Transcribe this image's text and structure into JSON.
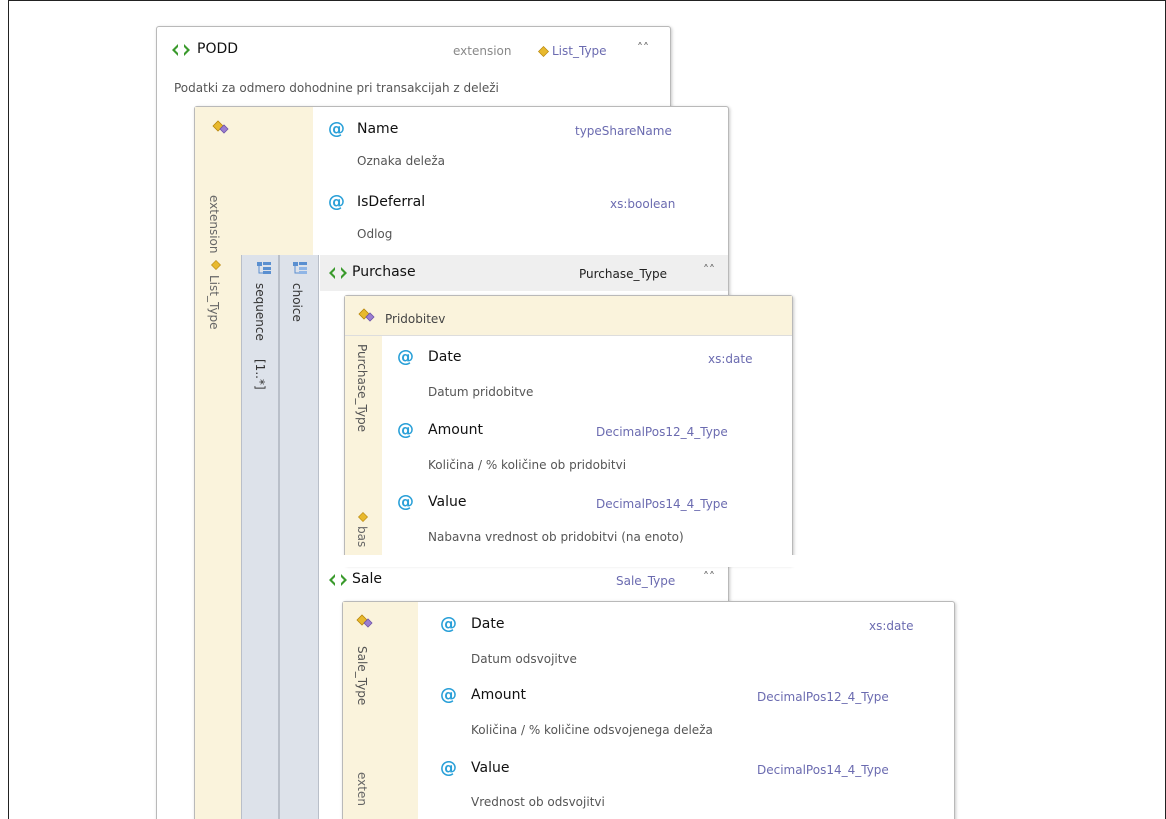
{
  "podd": {
    "name": "PODD",
    "extension_label": "extension",
    "extension_type": "List_Type",
    "description": "Podatki za odmero dohodnine pri transakcijah z deleži"
  },
  "list_ext": {
    "vertical_label": "extension",
    "vertical_type": "List_Type",
    "sequence_label": "sequence",
    "sequence_mult": "[1..*]",
    "choice_label": "choice"
  },
  "attributes": [
    {
      "name": "Name",
      "type": "typeShareName",
      "description": "Oznaka deleža"
    },
    {
      "name": "IsDeferral",
      "type": "xs:boolean",
      "description": "Odlog"
    }
  ],
  "purchase": {
    "name": "Purchase",
    "type": "Purchase_Type",
    "header_label": "Pridobitev",
    "vertical_type": "Purchase_Type",
    "vertical_base": "bas",
    "attributes": [
      {
        "name": "Date",
        "type": "xs:date",
        "description": "Datum pridobitve"
      },
      {
        "name": "Amount",
        "type": "DecimalPos12_4_Type",
        "description": "Količina / % količine ob pridobitvi"
      },
      {
        "name": "Value",
        "type": "DecimalPos14_4_Type",
        "description": "Nabavna vrednost ob pridobitvi (na enoto)"
      }
    ]
  },
  "sale": {
    "name": "Sale",
    "type": "Sale_Type",
    "vertical_type": "Sale_Type",
    "vertical_ext": "exten",
    "attributes": [
      {
        "name": "Date",
        "type": "xs:date",
        "description": "Datum odsvojitve"
      },
      {
        "name": "Amount",
        "type": "DecimalPos12_4_Type",
        "description": "Količina / % količine odsvojenega deleža"
      },
      {
        "name": "Value",
        "type": "DecimalPos14_4_Type",
        "description": "Vrednost ob odsvojitvi"
      }
    ]
  },
  "icons": {
    "element": "element-icon",
    "attribute": "attribute-icon",
    "collapse": "collapse-icon",
    "extension": "extension-icon",
    "sequence": "sequence-icon",
    "choice": "choice-icon",
    "type_diamond": "type-diamond-icon"
  },
  "colors": {
    "element_green": "#3a9a2c",
    "attribute_blue": "#2aa0d8",
    "type_purple": "#6b6bb0",
    "beige": "#faf3dc",
    "compositor_blue": "#dde2ea"
  }
}
